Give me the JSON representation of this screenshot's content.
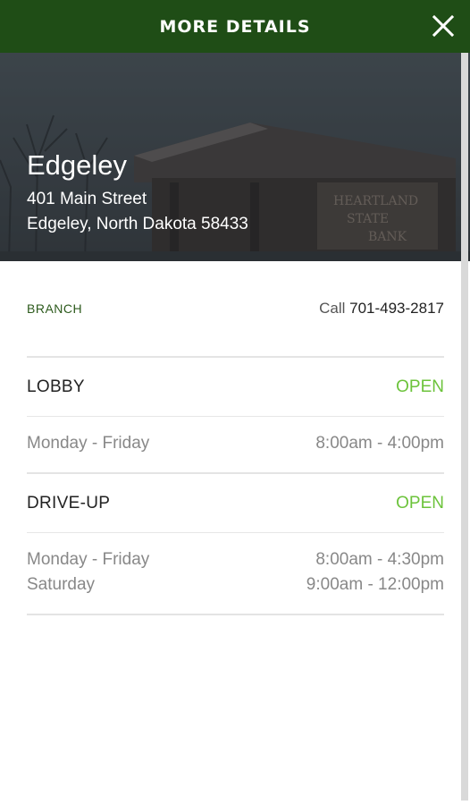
{
  "header": {
    "title": "MORE DETAILS",
    "close_icon": "close-icon"
  },
  "hero": {
    "branch_name": "Edgeley",
    "address_line1": "401 Main Street",
    "address_line2": "Edgeley, North Dakota 58433",
    "sign_text": [
      "HEARTLAND",
      "STATE",
      "BANK"
    ]
  },
  "branch": {
    "label": "BRANCH",
    "call_prefix": "Call",
    "phone": "701-493-2817"
  },
  "lobby": {
    "title": "LOBBY",
    "status": "OPEN",
    "hours": [
      {
        "days": "Monday - Friday",
        "time": "8:00am - 4:00pm"
      }
    ]
  },
  "drive_up": {
    "title": "DRIVE-UP",
    "status": "OPEN",
    "hours": [
      {
        "days": "Monday - Friday",
        "time": "8:00am - 4:30pm"
      },
      {
        "days": "Saturday",
        "time": "9:00am - 12:00pm"
      }
    ]
  },
  "colors": {
    "header_bg": "#1f4d16",
    "open_status": "#6cc33b",
    "branch_label": "#2c5a1c"
  }
}
